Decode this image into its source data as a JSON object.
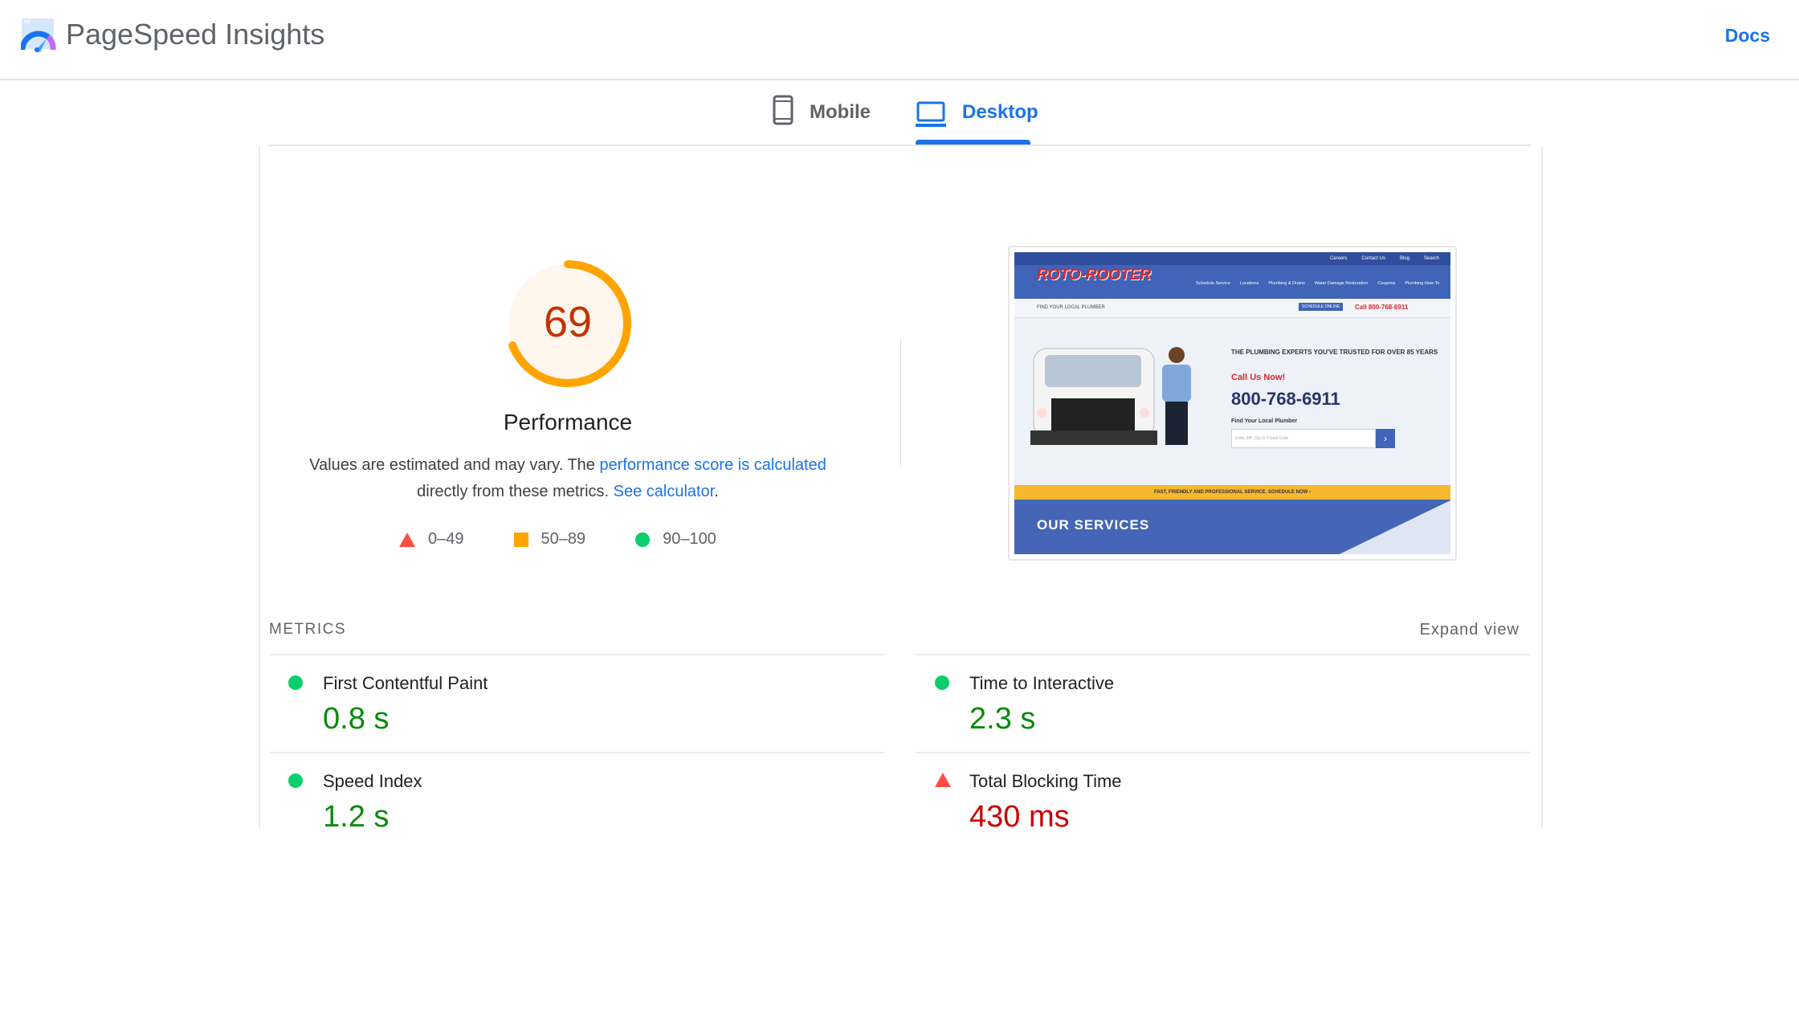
{
  "header": {
    "title": "PageSpeed Insights",
    "docs_label": "Docs"
  },
  "tabs": [
    {
      "label": "Mobile",
      "icon": "phone-icon",
      "active": false
    },
    {
      "label": "Desktop",
      "icon": "laptop-icon",
      "active": true
    }
  ],
  "score": {
    "value": "69",
    "fraction": 0.69,
    "label": "Performance",
    "color": "#ffa400",
    "text_color": "#c33300"
  },
  "description": {
    "text1": "Values are estimated and may vary. The ",
    "link1": "performance score is calculated",
    "text2": "directly from these metrics. ",
    "link2": "See calculator",
    "text3": "."
  },
  "legend": [
    {
      "range": "0–49",
      "shape": "triangle",
      "color": "#ff4e42"
    },
    {
      "range": "50–89",
      "shape": "square",
      "color": "#ffa400"
    },
    {
      "range": "90–100",
      "shape": "circle",
      "color": "#0cce6b"
    }
  ],
  "screenshot": {
    "brand": "ROTO-ROOTER",
    "nav_top": [
      "Careers",
      "Contact Us",
      "Blog",
      "Search"
    ],
    "nav_main": [
      "Schedule Service",
      "Locations",
      "Plumbing & Drains",
      "Water Damage Restoration",
      "Coupons",
      "Plumbing How-To"
    ],
    "find_local": "FIND YOUR LOCAL PLUMBER",
    "schedule_btn": "SCHEDULE ONLINE",
    "call_top": "Call 800-768-6911",
    "headline": "THE PLUMBING EXPERTS YOU'VE TRUSTED FOR OVER 85 YEARS",
    "call_now": "Call Us Now!",
    "phone": "800-768-6911",
    "find_label": "Find Your Local Plumber",
    "zip_placeholder": "Enter ZIP, City or Postal Code",
    "banner": "FAST, FRIENDLY AND PROFESSIONAL SERVICE. SCHEDULE NOW ›",
    "services": "OUR SERVICES"
  },
  "metrics": {
    "label": "METRICS",
    "expand_label": "Expand view",
    "items": [
      {
        "name": "First Contentful Paint",
        "value": "0.8 s",
        "status": "good"
      },
      {
        "name": "Time to Interactive",
        "value": "2.3 s",
        "status": "good"
      },
      {
        "name": "Speed Index",
        "value": "1.2 s",
        "status": "good"
      },
      {
        "name": "Total Blocking Time",
        "value": "430 ms",
        "status": "poor"
      }
    ]
  },
  "colors": {
    "accent": "#1a73e8",
    "good": "#0a8a0a",
    "poor": "#cc0000"
  }
}
